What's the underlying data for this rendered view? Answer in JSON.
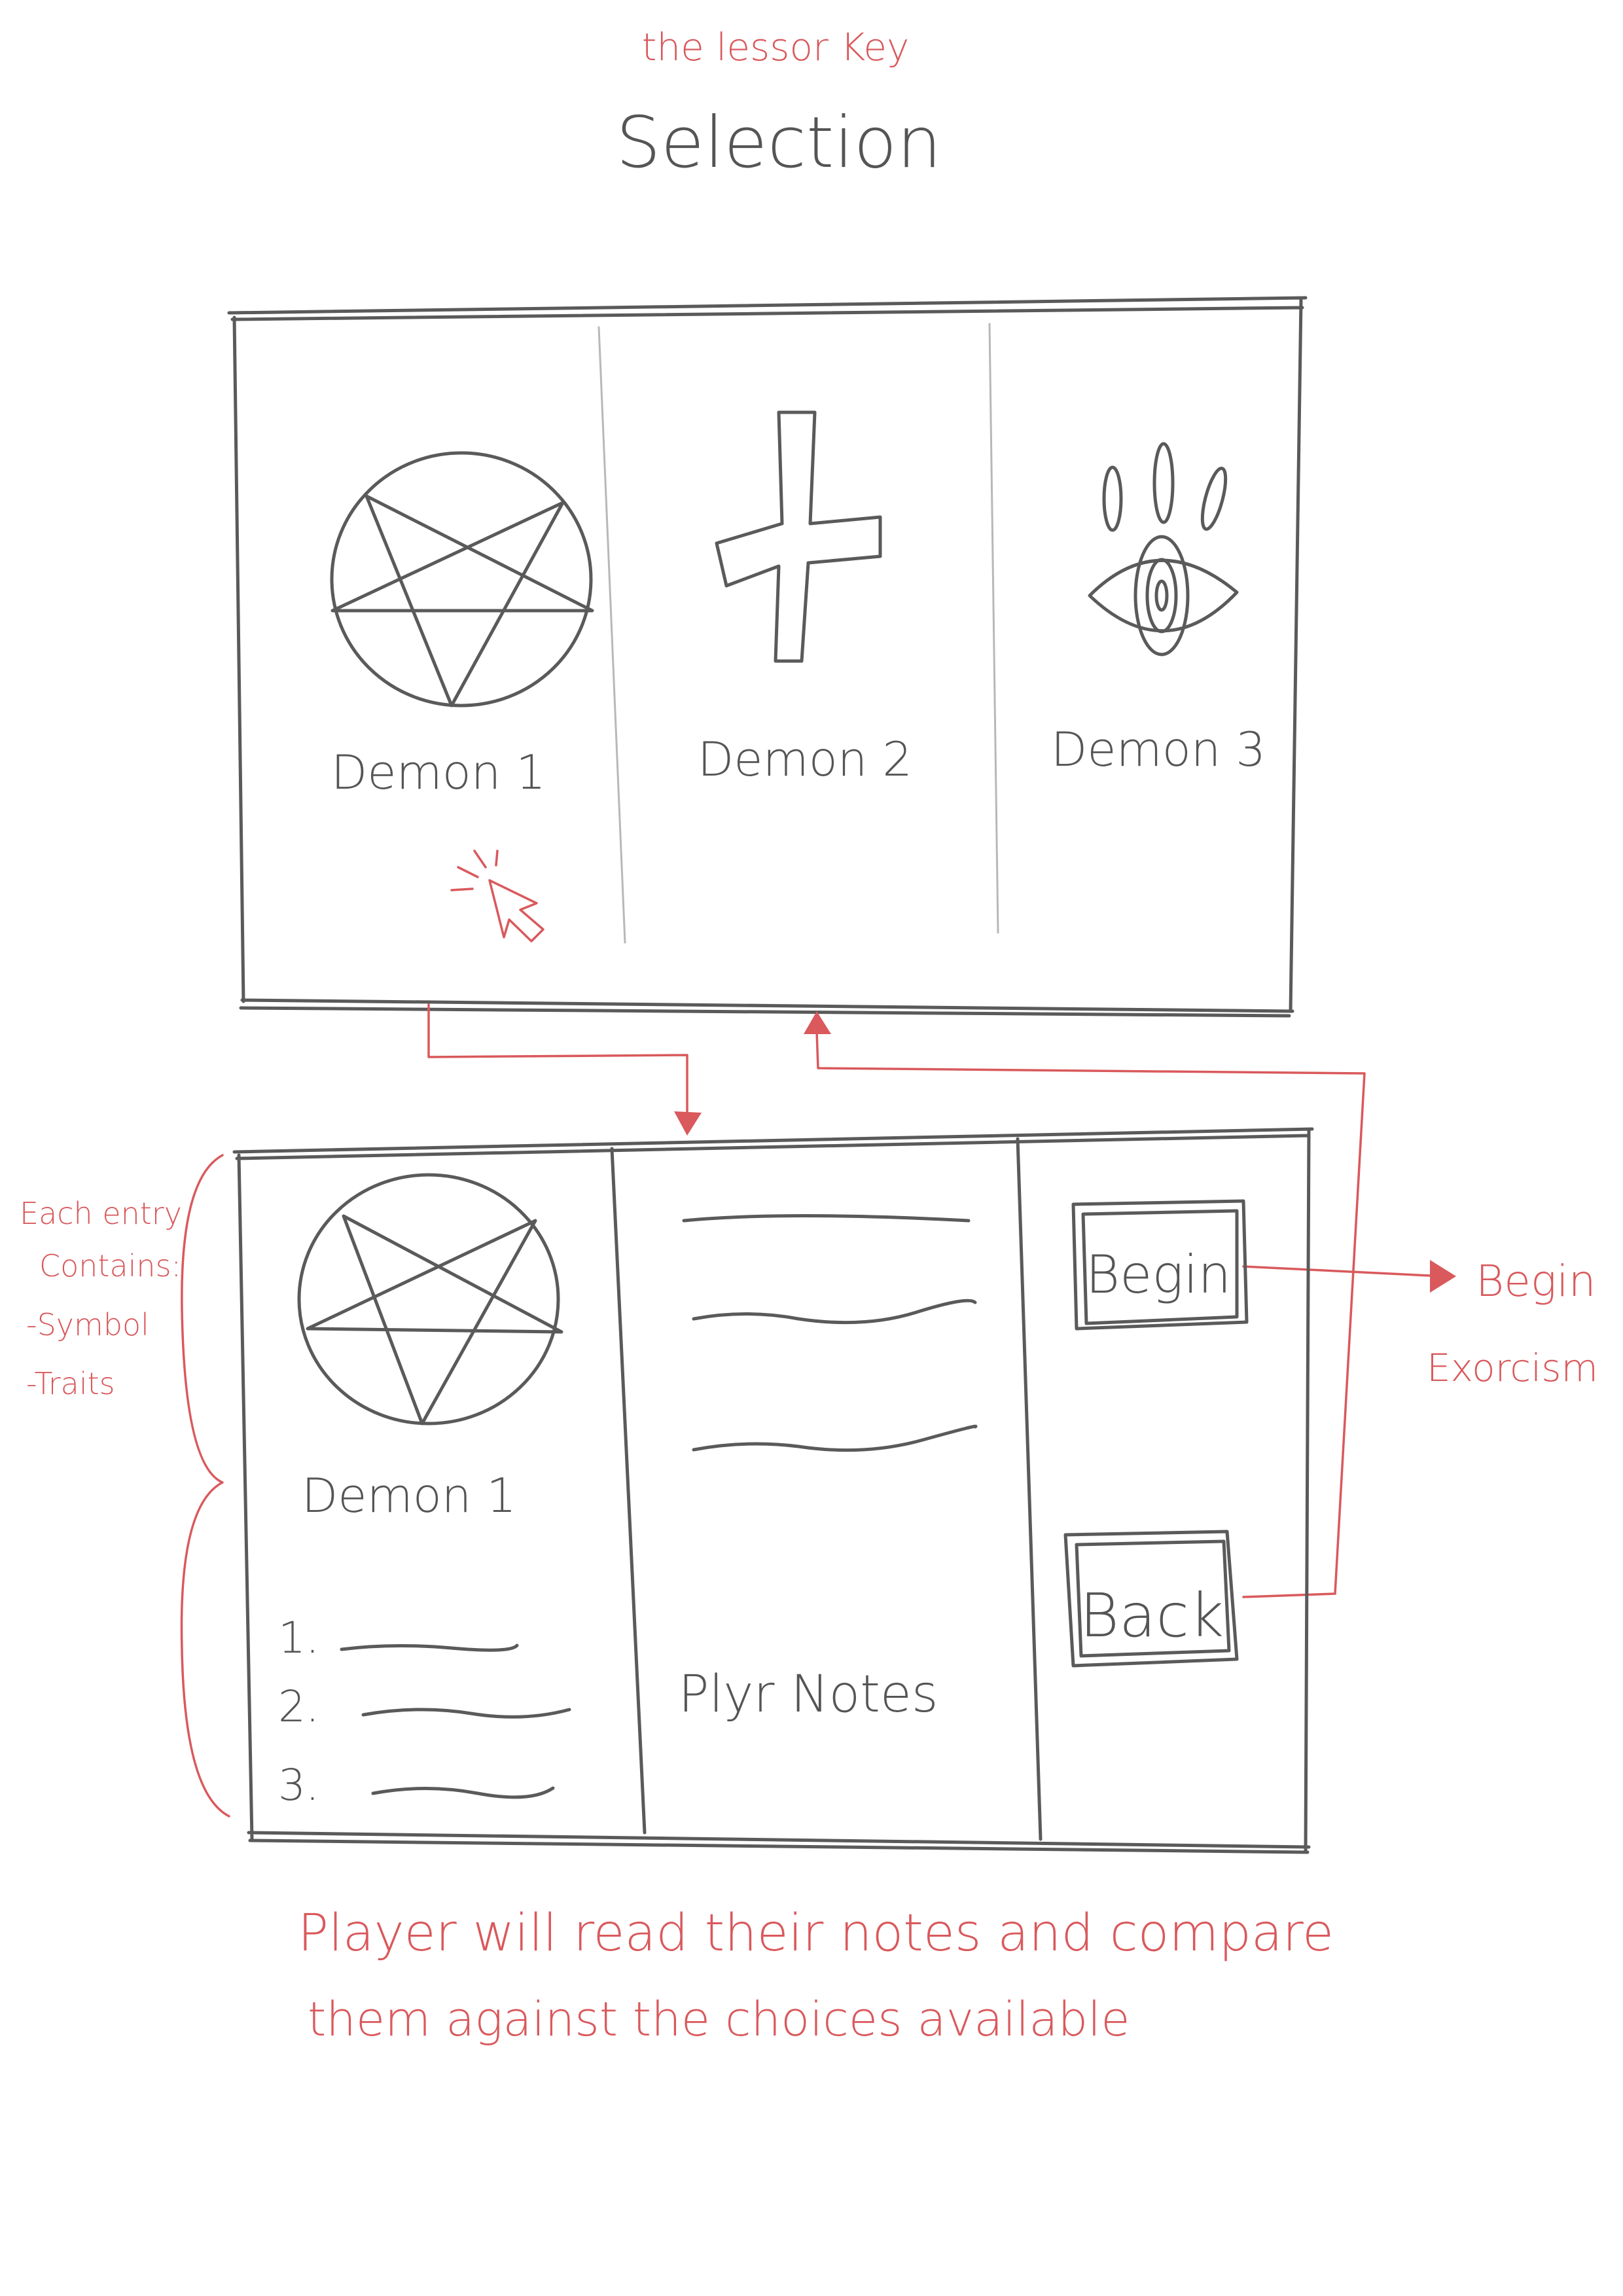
{
  "header": {
    "subtitle": "the lessor Key",
    "title": "Selection"
  },
  "selection_screen": {
    "demons": [
      {
        "label": "Demon 1",
        "symbol": "pentagram-icon"
      },
      {
        "label": "Demon 2",
        "symbol": "inverted-cross-icon"
      },
      {
        "label": "Demon 3",
        "symbol": "eye-icon"
      }
    ]
  },
  "detail_screen": {
    "demon_label": "Demon 1",
    "trait_numbers": [
      "1.",
      "2.",
      "3."
    ],
    "notes_label": "Plyr Notes",
    "begin_button": "Begin",
    "back_button": "Back"
  },
  "annotations": {
    "entry_note": [
      "Each entry",
      "Contains:",
      "-Symbol",
      "-Traits"
    ],
    "begin_result": [
      "Begin",
      "Exorcism"
    ],
    "footer": [
      "Player will read their notes and compare",
      "them against the choices available"
    ]
  },
  "colors": {
    "ink": "#5a5a5a",
    "annotation": "#d9595c"
  }
}
